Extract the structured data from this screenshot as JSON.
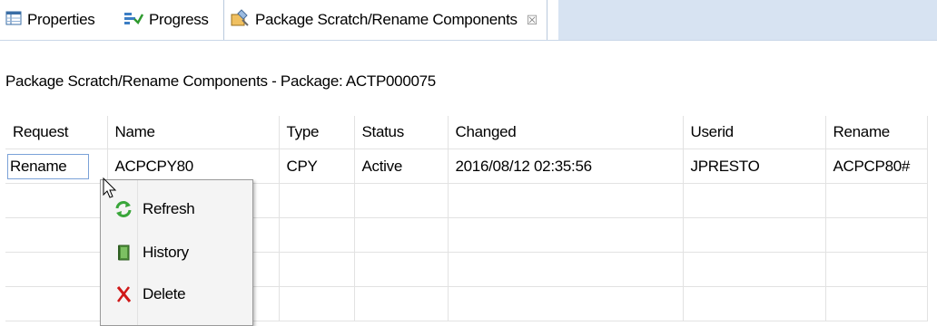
{
  "tabs": [
    {
      "label": "Properties",
      "icon": "properties-icon"
    },
    {
      "label": "Progress",
      "icon": "progress-icon"
    },
    {
      "label": "Package Scratch/Rename Components",
      "icon": "package-icon",
      "active": true,
      "close": "☒"
    }
  ],
  "title": "Package Scratch/Rename Components - Package: ACTP000075",
  "table": {
    "columns": [
      "Request",
      "Name",
      "Type",
      "Status",
      "Changed",
      "Userid",
      "Rename"
    ],
    "rows": [
      {
        "request": "Rename",
        "name": "ACPCPY80",
        "type": "CPY",
        "status": "Active",
        "changed": "2016/08/12 02:35:56",
        "userid": "JPRESTO",
        "rename": "ACPCP80#"
      }
    ]
  },
  "context_menu": {
    "items": [
      {
        "label": "Refresh",
        "icon": "refresh-icon"
      },
      {
        "label": "History",
        "icon": "history-icon"
      },
      {
        "label": "Delete",
        "icon": "delete-icon"
      }
    ]
  },
  "colors": {
    "tabbar_fill": "#d7e3f2",
    "selection_border": "#7ba2d8",
    "delete_red": "#d01818",
    "refresh_green": "#39a63a"
  }
}
